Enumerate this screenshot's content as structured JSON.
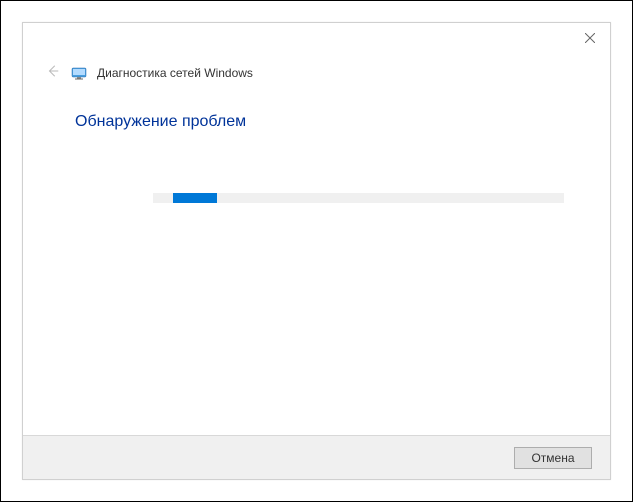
{
  "window": {
    "title": "Диагностика сетей Windows",
    "heading": "Обнаружение проблем"
  },
  "progress": {
    "percent": 12
  },
  "footer": {
    "cancel_label": "Отмена"
  }
}
